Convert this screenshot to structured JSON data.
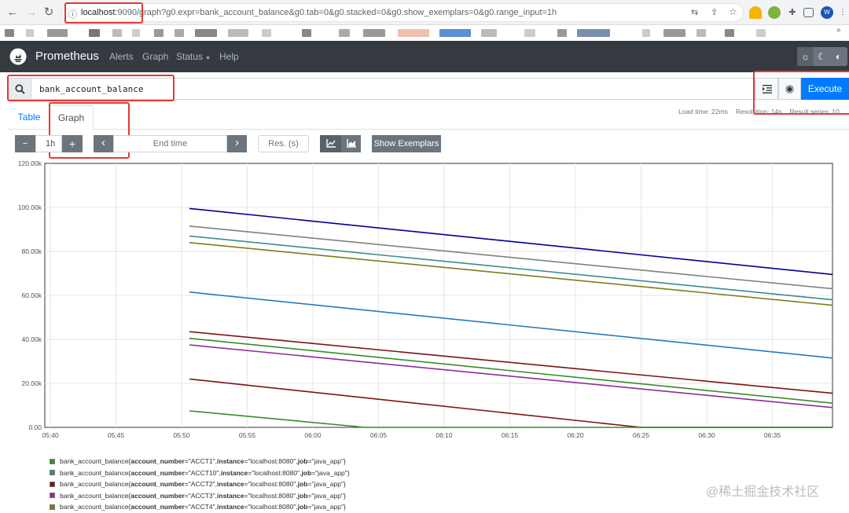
{
  "browser": {
    "url_host": "localhost",
    "url_port": ":9090",
    "url_path": "/graph?g0.expr=bank_account_balance&g0.tab=0&g0.stacked=0&g0.show_exemplars=0&g0.range_input=1h",
    "avatar_letter": "W"
  },
  "navbar": {
    "brand": "Prometheus",
    "links": [
      "Alerts",
      "Graph",
      "Status",
      "Help"
    ]
  },
  "query": {
    "expression": "bank_account_balance",
    "execute_label": "Execute"
  },
  "stats": {
    "load_time": "Load time: 22ms",
    "resolution": "Resolution: 14s",
    "result_series": "Result series: 10"
  },
  "tabs": [
    "Table",
    "Graph"
  ],
  "controls": {
    "minus": "−",
    "range": "1h",
    "plus": "+",
    "prev": "‹",
    "end_time_placeholder": "End time",
    "next": "›",
    "res_placeholder": "Res. (s)",
    "show_exemplars": "Show Exemplars"
  },
  "chart_data": {
    "type": "line",
    "x_ticks": [
      "05:40",
      "05:45",
      "05:50",
      "05:55",
      "06:00",
      "06:05",
      "06:10",
      "06:15",
      "06:20",
      "06:25",
      "06:30",
      "06:35"
    ],
    "y_ticks": [
      "0.00",
      "20.00k",
      "40.00k",
      "60.00k",
      "80.00k",
      "100.00k",
      "120.00k"
    ],
    "ylim": [
      0,
      120000
    ],
    "xlim_minutes": [
      0,
      59.6
    ],
    "grid": true,
    "series": [
      {
        "name": "bank_account_balance{account_number=\"ACCT1\", instance=\"localhost:8080\", job=\"java_app\"}",
        "color": "#3a8c2c",
        "points": [
          [
            10.6,
            40500
          ],
          [
            59.6,
            11000
          ]
        ]
      },
      {
        "name": "bank_account_balance{account_number=\"ACCT10\", instance=\"localhost:8080\", job=\"java_app\"}",
        "color": "#3d8c8c",
        "points": [
          [
            10.6,
            87000
          ],
          [
            59.6,
            58000
          ]
        ]
      },
      {
        "name": "bank_account_balance{account_number=\"ACCT2\", instance=\"localhost:8080\", job=\"java_app\"}",
        "color": "#7a1414",
        "points": [
          [
            10.6,
            43500
          ],
          [
            59.6,
            15500
          ]
        ]
      },
      {
        "name": "bank_account_balance{account_number=\"ACCT3\", instance=\"localhost:8080\", job=\"java_app\"}",
        "color": "#8e2b9c",
        "points": [
          [
            10.6,
            37500
          ],
          [
            59.6,
            9000
          ]
        ]
      },
      {
        "name": "bank_account_balance{account_number=\"ACCT4\", instance=\"localhost:8080\", job=\"java_app\"}",
        "color": "#7d7d1a",
        "points": [
          [
            10.6,
            84000
          ],
          [
            59.6,
            55500
          ]
        ]
      },
      {
        "name": "",
        "color": "#000090",
        "points": [
          [
            10.6,
            99500
          ],
          [
            59.6,
            69500
          ]
        ]
      },
      {
        "name": "",
        "color": "#808080",
        "points": [
          [
            10.6,
            91500
          ],
          [
            59.6,
            63000
          ]
        ]
      },
      {
        "name": "",
        "color": "#2a7ab8",
        "points": [
          [
            10.6,
            61500
          ],
          [
            59.6,
            31500
          ]
        ]
      },
      {
        "name": "",
        "color": "#7a1414",
        "points": [
          [
            10.6,
            22000
          ],
          [
            45.0,
            0
          ],
          [
            59.6,
            0
          ]
        ]
      },
      {
        "name": "",
        "color": "#3a8c2c",
        "points": [
          [
            10.6,
            7500
          ],
          [
            24.0,
            0
          ],
          [
            59.6,
            0
          ]
        ]
      }
    ]
  },
  "legend": [
    {
      "metric": "bank_account_balance{",
      "account": "ACCT1",
      "color": "#3a8c2c"
    },
    {
      "metric": "bank_account_balance{",
      "account": "ACCT10",
      "color": "#3d8c8c"
    },
    {
      "metric": "bank_account_balance{",
      "account": "ACCT2",
      "color": "#7a1414"
    },
    {
      "metric": "bank_account_balance{",
      "account": "ACCT3",
      "color": "#8e2b9c"
    },
    {
      "metric": "bank_account_balance{",
      "account": "ACCT4",
      "color": "#7d7d1a"
    }
  ],
  "legend_text": {
    "k_account": "account_number",
    "k_instance": "instance",
    "v_instance": "=\"localhost:8080\", ",
    "k_job": "job",
    "v_job": "=\"java_app\"}"
  },
  "watermark": "@稀土掘金技术社区"
}
